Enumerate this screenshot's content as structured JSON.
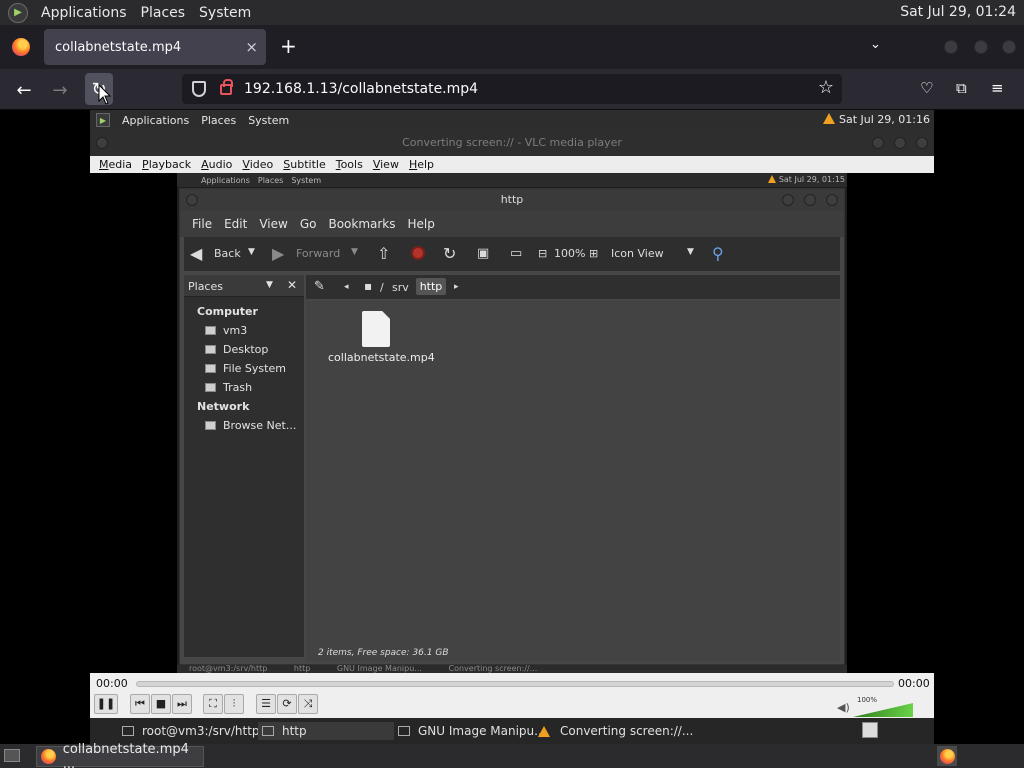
{
  "outer_panel": {
    "menus": [
      "Applications",
      "Places",
      "System"
    ],
    "clock": "Sat Jul 29, 01:24"
  },
  "browser": {
    "tab_title": "collabnetstate.mp4",
    "tab_close": "×",
    "new_tab": "+",
    "url": "192.168.1.13/collabnetstate.mp4"
  },
  "vlc": {
    "panel_menus": [
      "Applications",
      "Places",
      "System"
    ],
    "panel_clock": "Sat Jul 29, 01:16",
    "window_title": "Converting screen:// - VLC media player",
    "menus": [
      "Media",
      "Playback",
      "Audio",
      "Video",
      "Subtitle",
      "Tools",
      "View",
      "Help"
    ],
    "time_start": "00:00",
    "time_end": "00:00",
    "volume": "100%"
  },
  "inner": {
    "panel_menus": [
      "Applications",
      "Places",
      "System"
    ],
    "panel_clock": "Sat Jul 29, 01:15",
    "window_title": "http",
    "menus": [
      "File",
      "Edit",
      "View",
      "Go",
      "Bookmarks",
      "Help"
    ],
    "toolbar": {
      "back": "Back",
      "forward": "Forward",
      "zoom": "100%",
      "view_mode": "Icon View"
    },
    "sidebar": {
      "header": "Places",
      "computer_label": "Computer",
      "items_computer": [
        "vm3",
        "Desktop",
        "File System",
        "Trash"
      ],
      "network_label": "Network",
      "items_network": [
        "Browse Net..."
      ]
    },
    "location": {
      "sep": "/",
      "path_srv": "srv",
      "path_http": "http"
    },
    "file_name": "collabnetstate.mp4",
    "status": "2 items, Free space: 36.1 GB",
    "taskbar": [
      "root@vm3:/srv/http",
      "http",
      "GNU Image Manipu...",
      "Converting screen://..."
    ]
  },
  "taskbar1": {
    "items": [
      "root@vm3:/srv/http",
      "http",
      "GNU Image Manipu...",
      "Converting screen://..."
    ]
  },
  "taskbar2": {
    "item": "collabnetstate.mp4 ..."
  }
}
